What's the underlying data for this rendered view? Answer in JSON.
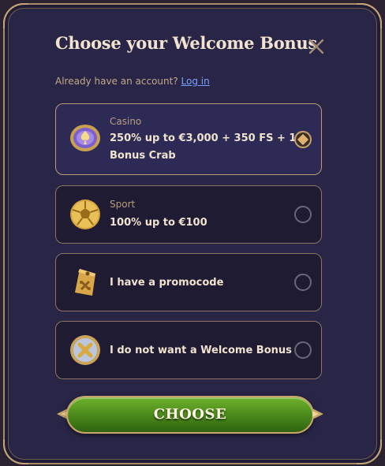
{
  "modal": {
    "title": "Choose your Welcome Bonus",
    "login_prompt": "Already have an account?",
    "login_link": "Log in",
    "close_icon": "close-icon"
  },
  "options": [
    {
      "category": "Casino",
      "label_line1": "250% up to €3,000 + 350 FS + 1",
      "label_line2": "Bonus Crab",
      "icon": "casino-chip-icon",
      "selected": true
    },
    {
      "category": "Sport",
      "label": "100% up to €100",
      "icon": "football-icon",
      "selected": false
    },
    {
      "label": "I have a promocode",
      "icon": "promo-tag-icon",
      "selected": false
    },
    {
      "label": "I do not want a Welcome Bonus",
      "icon": "no-bonus-icon",
      "selected": false
    }
  ],
  "button": {
    "label": "CHOOSE"
  },
  "colors": {
    "panel": "#282546",
    "border_gold": "#a88a63",
    "title": "#f1e3cf",
    "link": "#7aa3ff",
    "button_green": "#4f8f1d"
  }
}
